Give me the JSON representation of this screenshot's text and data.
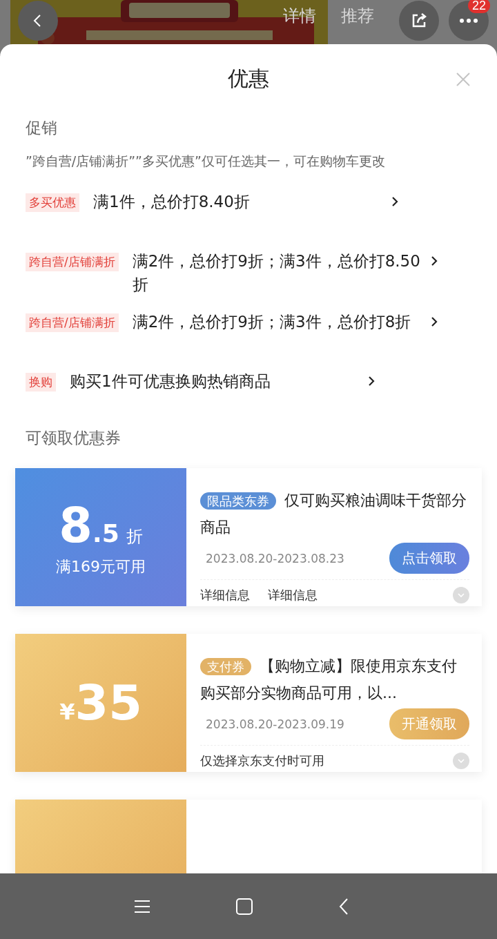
{
  "header": {
    "tabs": [
      {
        "label": "详情"
      },
      {
        "label": "推荐"
      }
    ],
    "badge": "22"
  },
  "sheet": {
    "title": "优惠",
    "promotion_section": {
      "title": "促销",
      "note": "”跨自营/店铺满折””多买优惠”仅可任选其一，可在购物车更改",
      "items": [
        {
          "tag": "多买优惠",
          "text": "满1件，总价打8.40折"
        },
        {
          "tag": "跨自营/店铺满折",
          "text": "满2件，总价打9折；满3件，总价打8.50折"
        },
        {
          "tag": "跨自营/店铺满折",
          "text": "满2件，总价打9折；满3件，总价打8折"
        },
        {
          "tag": "换购",
          "text": "购买1件可优惠换购热销商品"
        }
      ]
    },
    "coupon_section": {
      "title": "可领取优惠券",
      "coupons": [
        {
          "kind": "discount",
          "value": "8",
          "decimal": ".5",
          "unit": "折",
          "condition": "满169元可用",
          "tag": "限品类东券",
          "title": "仅可购买粮油调味干货部分商品",
          "date": "2023.08.20-2023.08.23",
          "button": "点击领取",
          "details": [
            "详细信息",
            "详细信息"
          ]
        },
        {
          "kind": "cash",
          "currency": "¥",
          "value": "35",
          "tag": "支付券",
          "title": "【购物立减】限使用京东支付购买部分实物商品可用，以...",
          "date": "2023.08.20-2023.09.19",
          "button": "开通领取",
          "details": [
            "仅选择京东支付时可用"
          ]
        },
        {
          "kind": "partial"
        }
      ]
    }
  }
}
